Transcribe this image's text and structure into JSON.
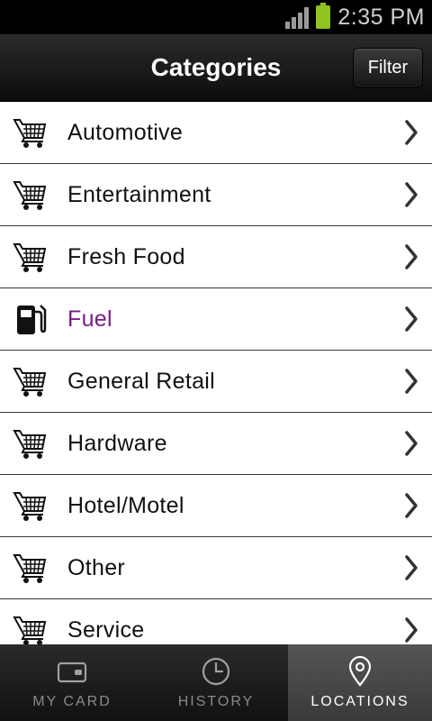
{
  "status_bar": {
    "time": "2:35 PM"
  },
  "header": {
    "title": "Categories",
    "filter_label": "Filter"
  },
  "list": {
    "items": [
      {
        "label": "Automotive",
        "icon": "cart-icon"
      },
      {
        "label": "Entertainment",
        "icon": "cart-icon"
      },
      {
        "label": "Fresh Food",
        "icon": "cart-icon"
      },
      {
        "label": "Fuel",
        "icon": "fuel-pump-icon",
        "active": true
      },
      {
        "label": "General Retail",
        "icon": "cart-icon"
      },
      {
        "label": "Hardware",
        "icon": "cart-icon"
      },
      {
        "label": "Hotel/Motel",
        "icon": "cart-icon"
      },
      {
        "label": "Other",
        "icon": "cart-icon"
      },
      {
        "label": "Service",
        "icon": "cart-icon"
      }
    ]
  },
  "tabbar": {
    "tabs": [
      {
        "label": "My Card",
        "icon": "wallet-icon"
      },
      {
        "label": "History",
        "icon": "clock-icon"
      },
      {
        "label": "Locations",
        "icon": "location-pin-icon",
        "active": true
      }
    ]
  },
  "colors": {
    "active_label": "#7a1b86",
    "battery": "#8fc31f"
  }
}
